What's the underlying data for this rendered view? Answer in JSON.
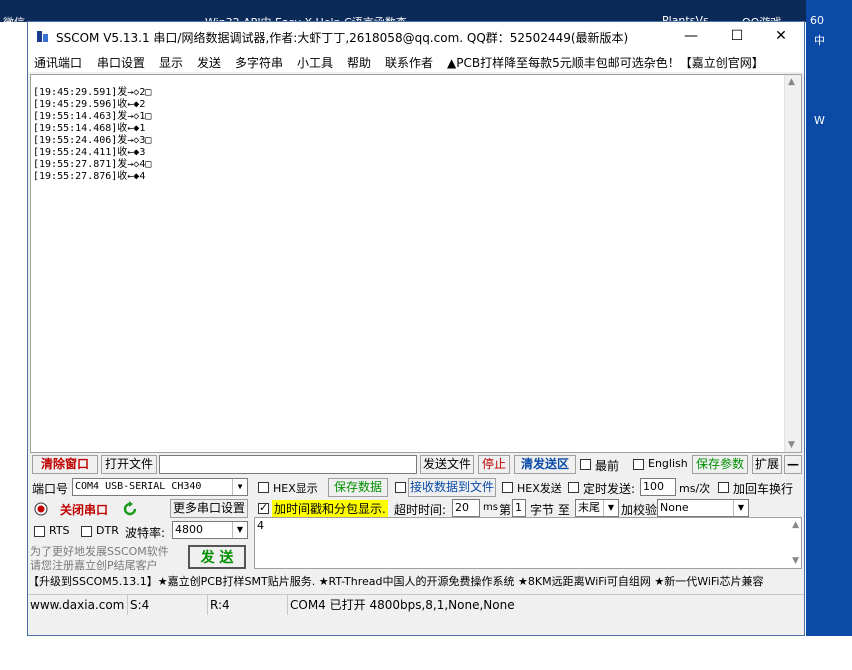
{
  "desktop": {
    "top_labels": [
      "微信",
      "Win32 API中  Easy X Help  C语言函数查",
      "PlantsVs",
      "QQ游戏",
      "60"
    ],
    "right_labels": [
      "中",
      "W"
    ]
  },
  "window": {
    "title": "SSCOM V5.13.1 串口/网络数据调试器,作者:大虾丁丁,2618058@qq.com. QQ群：52502449(最新版本)",
    "minimize": "—",
    "maximize": "☐",
    "close": "✕"
  },
  "menu": [
    "通讯端口",
    "串口设置",
    "显示",
    "发送",
    "多字符串",
    "小工具",
    "帮助",
    "联系作者",
    "▲PCB打样降至每款5元顺丰包邮可选杂色！【嘉立创官网】"
  ],
  "output_lines": [
    "[19:45:29.591]发→◇2□",
    "[19:45:29.596]收←◆2",
    "[19:55:14.463]发→◇1□",
    "[19:55:14.468]收←◆1",
    "[19:55:24.406]发→◇3□",
    "[19:55:24.411]收←◆3",
    "[19:55:27.871]发→◇4□",
    "[19:55:27.876]收←◆4"
  ],
  "toolbar1": {
    "clear_window": "清除窗口",
    "open_file": "打开文件",
    "send_file": "发送文件",
    "stop": "停止",
    "clear_send": "清发送区",
    "topmost": "最前",
    "english": "English",
    "save_params": "保存参数",
    "expand": "扩展",
    "collapse": "—"
  },
  "toolbar2": {
    "port_label": "端口号",
    "port_value": "COM4 USB-SERIAL CH340",
    "hex_display": "HEX显示",
    "save_data": "保存数据",
    "recv_to_file": "接收数据到文件",
    "hex_send": "HEX发送",
    "timed_send": "定时发送:",
    "interval": "100",
    "interval_unit": "ms/次",
    "add_crlf": "加回车换行"
  },
  "toolbar3": {
    "close_port": "关闭串口",
    "more_settings": "更多串口设置",
    "timestamp": "加时间戳和分包显示.",
    "timeout_label": "超时时间:",
    "timeout_value": "20",
    "timeout_unit": "ms",
    "nth_label": "第",
    "nth_value": "1",
    "byte_label": "字节 至",
    "end_value": "末尾",
    "checksum_label": "加校验",
    "checksum_value": "None"
  },
  "toolbar4": {
    "rts": "RTS",
    "dtr": "DTR",
    "baud_label": "波特率:",
    "baud_value": "4800"
  },
  "promo": {
    "line1": "为了更好地发展SSCOM软件",
    "line2": "请您注册嘉立创P结尾客户"
  },
  "send_button": "发 送",
  "send_text": "4",
  "marquee": "【升级到SSCOM5.13.1】★嘉立创PCB打样SMT贴片服务. ★RT-Thread中国人的开源免费操作系统 ★8KM远距离WiFi可自组网 ★新一代WiFi芯片兼容",
  "status": {
    "site": "www.daxia.com",
    "sent": "S:4",
    "recv": "R:4",
    "port_state": "COM4 已打开  4800bps,8,1,None,None"
  },
  "colors": {
    "desktop_blue": "#0c4aa8",
    "red_button": "#c00000",
    "green_text": "#009000",
    "timestamp_highlight": "#ffff00"
  }
}
